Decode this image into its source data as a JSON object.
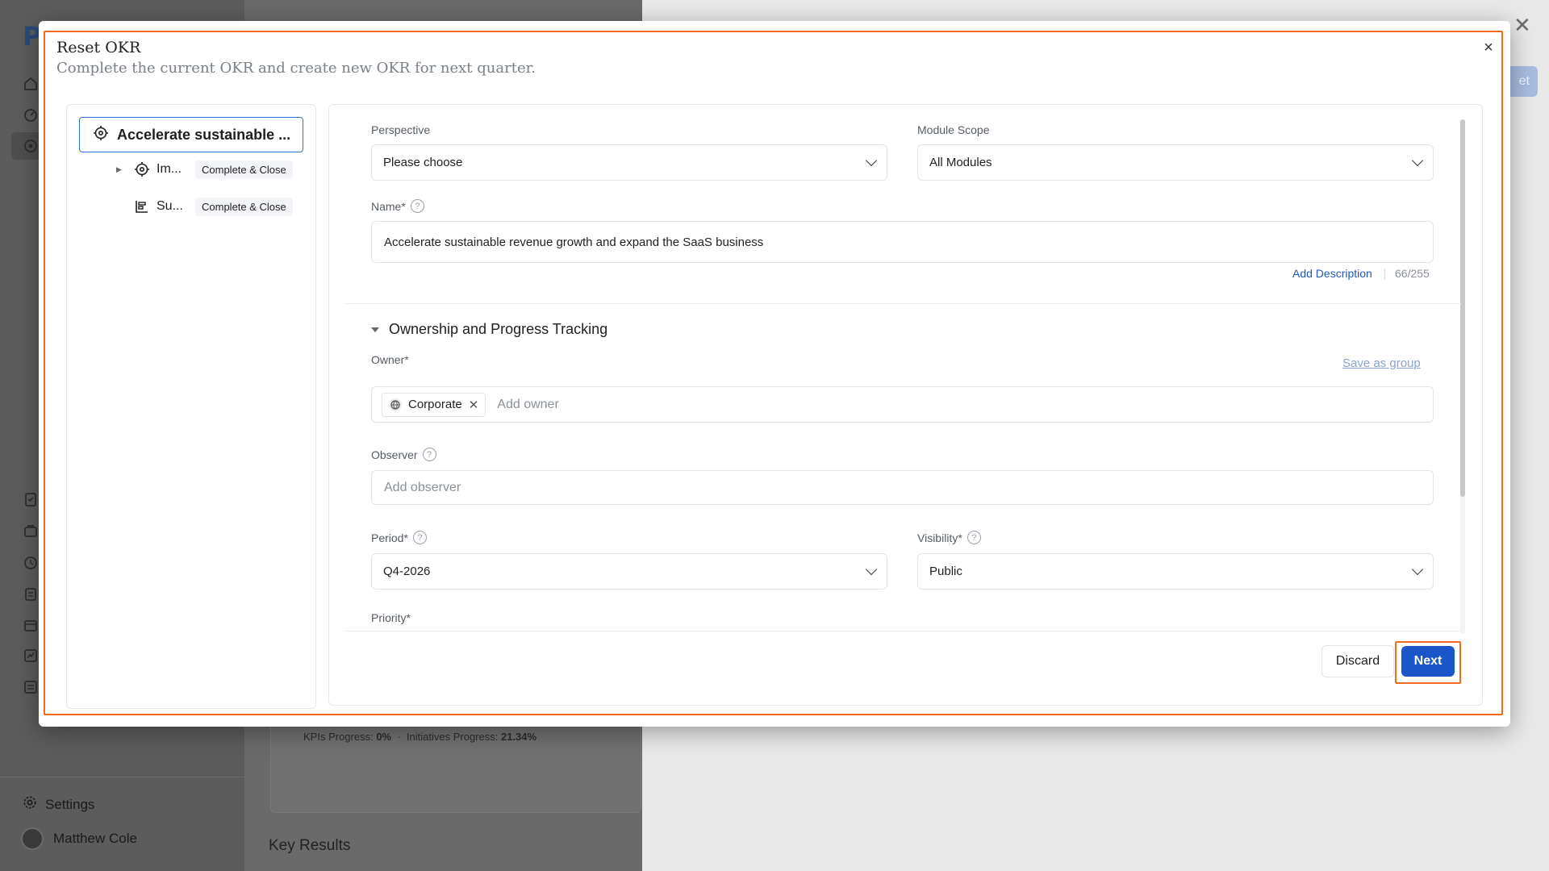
{
  "background": {
    "settings_label": "Settings",
    "user_name": "Matthew Cole",
    "progress": {
      "kpis_label": "KPIs Progress:",
      "kpis_value": "0%",
      "initiatives_label": "Initiatives Progress:",
      "initiatives_value": "21.34%"
    },
    "key_results_heading": "Key Results",
    "top_button_label": "et"
  },
  "modal": {
    "title": "Reset OKR",
    "subtitle": "Complete the current OKR and create new OKR for next quarter.",
    "close_label": "×"
  },
  "tree": {
    "root_label": "Accelerate sustainable ...",
    "children": [
      {
        "label": "Im...",
        "tag": "Complete & Close",
        "icon": "target-icon",
        "expandable": true
      },
      {
        "label": "Su...",
        "tag": "Complete & Close",
        "icon": "chart-list-icon",
        "expandable": false
      }
    ]
  },
  "form": {
    "perspective": {
      "label": "Perspective",
      "value": "Please choose"
    },
    "module_scope": {
      "label": "Module Scope",
      "value": "All Modules"
    },
    "name": {
      "label": "Name*",
      "value": "Accelerate sustainable revenue growth and expand the SaaS business",
      "add_description": "Add Description",
      "counter": "66/255"
    },
    "section_title": "Ownership and Progress Tracking",
    "owner": {
      "label": "Owner*",
      "save_as_group": "Save as group",
      "chip": "Corporate",
      "placeholder": "Add owner"
    },
    "observer": {
      "label": "Observer",
      "placeholder": "Add observer"
    },
    "period": {
      "label": "Period*",
      "value": "Q4-2026"
    },
    "visibility": {
      "label": "Visibility*",
      "value": "Public"
    },
    "priority": {
      "label": "Priority*"
    }
  },
  "buttons": {
    "discard": "Discard",
    "next": "Next"
  },
  "colors": {
    "primary": "#1a56c7",
    "highlight": "#f26b1d",
    "link": "#2358b8"
  }
}
